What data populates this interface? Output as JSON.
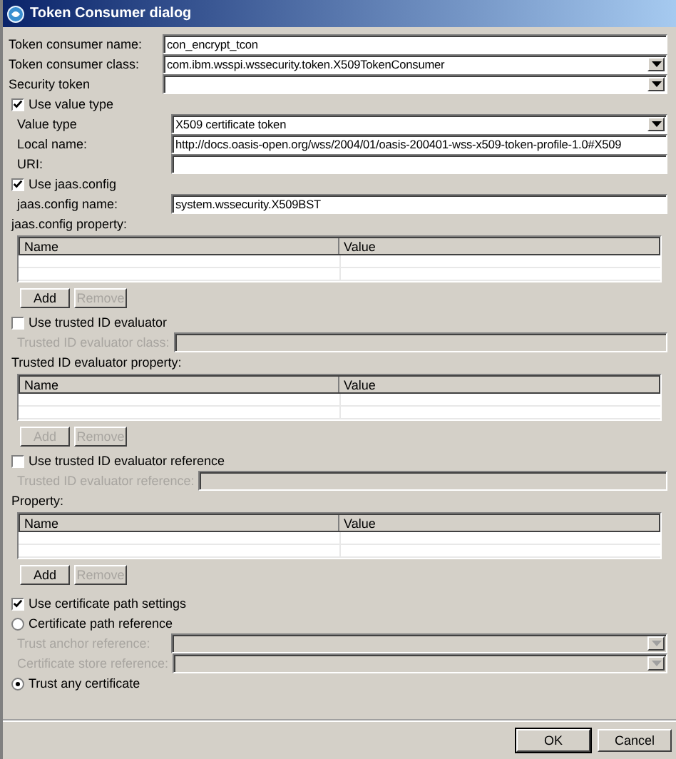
{
  "window": {
    "title": "Token Consumer dialog"
  },
  "items": [
    {
      "kind": "field",
      "label": "Token consumer name:",
      "value": "con_encrypt_tcon",
      "disabled": false
    },
    {
      "kind": "dropdown",
      "label": "Token consumer class:",
      "value": "com.ibm.wsspi.wssecurity.token.X509TokenConsumer",
      "disabled": false
    },
    {
      "kind": "dropdown",
      "label": "Security token",
      "disabled": false
    },
    {
      "kind": "checkbox",
      "label": "Use value type",
      "checked": true,
      "children": [
        {
          "kind": "dropdown",
          "label": "Value type",
          "value": "X509 certificate token",
          "disabled": false
        },
        {
          "kind": "field",
          "label": "Local name:",
          "value": "http://docs.oasis-open.org/wss/2004/01/oasis-200401-wss-x509-token-profile-1.0#X509",
          "disabled": false
        },
        {
          "kind": "field",
          "label": "URI:",
          "disabled": false
        }
      ]
    },
    {
      "kind": "checkbox",
      "label": "Use jaas.config",
      "checked": true,
      "children": [
        {
          "kind": "field",
          "label": "jaas.config name:",
          "value": "system.wssecurity.X509BST",
          "disabled": false
        },
        {
          "kind": "heading",
          "label": "jaas.config property:"
        },
        {
          "kind": "table",
          "columns": [
            "Name",
            "Value"
          ]
        },
        {
          "kind": "buttons",
          "buttons": [
            {
              "label": "Add",
              "disabled": false
            },
            {
              "label": "Remove",
              "disabled": true
            }
          ]
        }
      ]
    },
    {
      "kind": "checkbox",
      "label": "Use trusted ID evaluator",
      "checked": false,
      "children": [
        {
          "kind": "field",
          "label": "Trusted ID evaluator class:",
          "disabled": true
        }
      ]
    },
    {
      "kind": "heading",
      "label": "Trusted ID evaluator property:"
    },
    {
      "kind": "table",
      "columns": [
        "Name",
        "Value"
      ]
    },
    {
      "kind": "buttons",
      "buttons": [
        {
          "label": "Add",
          "disabled": true
        },
        {
          "label": "Remove",
          "disabled": true
        }
      ]
    },
    {
      "kind": "checkbox",
      "label": "Use trusted ID evaluator reference",
      "checked": false,
      "children": [
        {
          "kind": "field",
          "label": "Trusted ID evaluator reference:",
          "disabled": true
        }
      ]
    },
    {
      "kind": "heading",
      "label": "Property:"
    },
    {
      "kind": "table",
      "columns": [
        "Name",
        "Value"
      ]
    },
    {
      "kind": "buttons",
      "buttons": [
        {
          "label": "Add",
          "disabled": false
        },
        {
          "label": "Remove",
          "disabled": true
        }
      ]
    },
    {
      "kind": "spacer"
    },
    {
      "kind": "checkbox",
      "label": "Use certificate path settings",
      "checked": true
    },
    {
      "kind": "radio",
      "label": "Certificate path reference",
      "selected": false,
      "children": [
        {
          "kind": "dropdown",
          "label": "Trust anchor reference:",
          "disabled": true
        },
        {
          "kind": "dropdown",
          "label": "Certificate store reference:",
          "disabled": true
        }
      ]
    },
    {
      "kind": "radio",
      "label": "Trust any certificate",
      "selected": true
    }
  ],
  "footer": {
    "buttons": [
      {
        "label": "OK",
        "default": true
      },
      {
        "label": "Cancel",
        "default": false
      }
    ]
  }
}
